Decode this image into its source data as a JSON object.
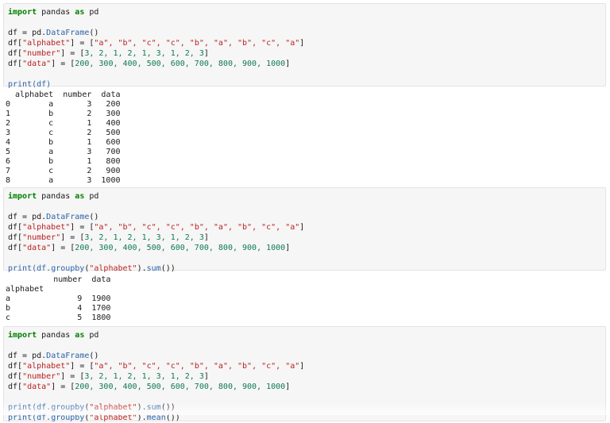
{
  "cells": [
    {
      "code": {
        "import_kw": "import",
        "import_mod": " pandas ",
        "as_kw": "as",
        "alias": " pd",
        "df_assign": "df = pd.",
        "df_ctor": "DataFrame",
        "df_paren": "()",
        "alpha_pre": "df[",
        "alpha_key": "\"alphabet\"",
        "alpha_mid": "] = [",
        "alpha_vals": "\"a\", \"b\", \"c\", \"c\", \"b\", \"a\", \"b\", \"c\", \"a\"",
        "alpha_end": "]",
        "num_pre": "df[",
        "num_key": "\"number\"",
        "num_mid": "] = [",
        "num_vals": "3, 2, 1, 2, 1, 3, 1, 2, 3",
        "num_end": "]",
        "data_pre": "df[",
        "data_key": "\"data\"",
        "data_mid": "] = [",
        "data_vals": "200, 300, 400, 500, 600, 700, 800, 900, 1000",
        "data_end": "]",
        "print_lines": [
          [
            {
              "t": "print(df)",
              "c": "fn"
            }
          ]
        ]
      },
      "output": [
        "  alphabet  number  data",
        "0        a       3   200",
        "1        b       2   300",
        "2        c       1   400",
        "3        c       2   500",
        "4        b       1   600",
        "5        a       3   700",
        "6        b       1   800",
        "7        c       2   900",
        "8        a       3  1000"
      ]
    },
    {
      "code": {
        "import_kw": "import",
        "import_mod": " pandas ",
        "as_kw": "as",
        "alias": " pd",
        "df_assign": "df = pd.",
        "df_ctor": "DataFrame",
        "df_paren": "()",
        "alpha_pre": "df[",
        "alpha_key": "\"alphabet\"",
        "alpha_mid": "] = [",
        "alpha_vals": "\"a\", \"b\", \"c\", \"c\", \"b\", \"a\", \"b\", \"c\", \"a\"",
        "alpha_end": "]",
        "num_pre": "df[",
        "num_key": "\"number\"",
        "num_mid": "] = [",
        "num_vals": "3, 2, 1, 2, 1, 3, 1, 2, 3",
        "num_end": "]",
        "data_pre": "df[",
        "data_key": "\"data\"",
        "data_mid": "] = [",
        "data_vals": "200, 300, 400, 500, 600, 700, 800, 900, 1000",
        "data_end": "]",
        "print_lines": [
          [
            {
              "t": "print(df.",
              "c": "fn"
            },
            {
              "t": "groupby",
              "c": "fn"
            },
            {
              "t": "(",
              "c": ""
            },
            {
              "t": "\"alphabet\"",
              "c": "str"
            },
            {
              "t": ").",
              "c": ""
            },
            {
              "t": "sum",
              "c": "fn"
            },
            {
              "t": "())",
              "c": ""
            }
          ]
        ]
      },
      "output": [
        "          number  data",
        "alphabet",
        "a              9  1900",
        "b              4  1700",
        "c              5  1800"
      ]
    },
    {
      "code": {
        "import_kw": "import",
        "import_mod": " pandas ",
        "as_kw": "as",
        "alias": " pd",
        "df_assign": "df = pd.",
        "df_ctor": "DataFrame",
        "df_paren": "()",
        "alpha_pre": "df[",
        "alpha_key": "\"alphabet\"",
        "alpha_mid": "] = [",
        "alpha_vals": "\"a\", \"b\", \"c\", \"c\", \"b\", \"a\", \"b\", \"c\", \"a\"",
        "alpha_end": "]",
        "num_pre": "df[",
        "num_key": "\"number\"",
        "num_mid": "] = [",
        "num_vals": "3, 2, 1, 2, 1, 3, 1, 2, 3",
        "num_end": "]",
        "data_pre": "df[",
        "data_key": "\"data\"",
        "data_mid": "] = [",
        "data_vals": "200, 300, 400, 500, 600, 700, 800, 900, 1000",
        "data_end": "]",
        "print_lines": [
          [
            {
              "t": "print(df.",
              "c": "fn"
            },
            {
              "t": "groupby",
              "c": "fn"
            },
            {
              "t": "(",
              "c": ""
            },
            {
              "t": "\"alphabet\"",
              "c": "str"
            },
            {
              "t": ").",
              "c": ""
            },
            {
              "t": "sum",
              "c": "fn"
            },
            {
              "t": "())",
              "c": ""
            }
          ],
          [
            {
              "t": "print(df.",
              "c": "fn"
            },
            {
              "t": "groupby",
              "c": "fn"
            },
            {
              "t": "(",
              "c": ""
            },
            {
              "t": "\"alphabet\"",
              "c": "str"
            },
            {
              "t": ").",
              "c": ""
            },
            {
              "t": "mean",
              "c": "fn"
            },
            {
              "t": "())",
              "c": ""
            }
          ]
        ]
      },
      "output": []
    }
  ]
}
